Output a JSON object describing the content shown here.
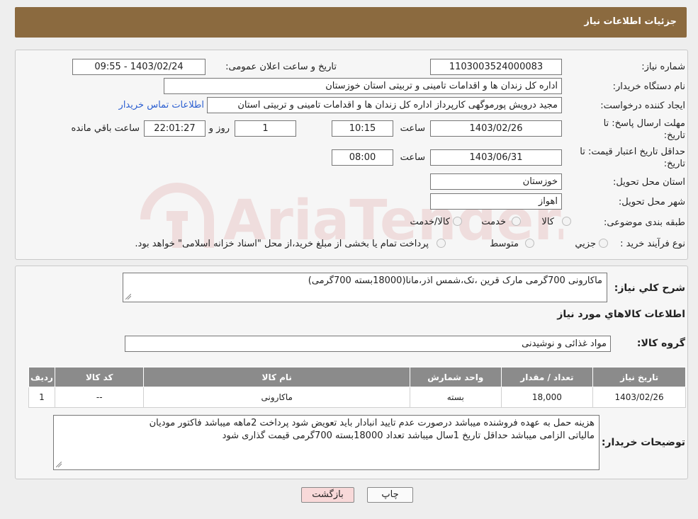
{
  "header": {
    "title": "جزئیات اطلاعات نیاز"
  },
  "form": {
    "need_number": {
      "label": "شماره نیاز:",
      "value": "1103003524000083"
    },
    "announce_datetime": {
      "label": "تاریخ و ساعت اعلان عمومی:",
      "value": "1403/02/24 - 09:55"
    },
    "buyer_org": {
      "label": "نام دستگاه خریدار:",
      "value": "اداره کل زندان ها و اقدامات تامینی و تربیتی استان خوزستان"
    },
    "requester": {
      "label": "ایجاد کننده درخواست:",
      "value": "مجید درویش پورموگهی کارپرداز اداره کل زندان ها و اقدامات تامینی و تربیتی استان",
      "link": "اطلاعات تماس خریدار"
    },
    "reply_deadline": {
      "label_line1": "مهلت ارسال پاسخ: تا",
      "label_line2": "تاریخ:",
      "date": "1403/02/26",
      "time_label": "ساعت",
      "time": "10:15",
      "days": "1",
      "days_label": "روز و",
      "remaining": "22:01:27",
      "remaining_label": "ساعت باقي مانده"
    },
    "price_validity": {
      "label_line1": "حداقل تاریخ اعتبار قیمت: تا",
      "label_line2": "تاریخ:",
      "date": "1403/06/31",
      "time_label": "ساعت",
      "time": "08:00"
    },
    "province": {
      "label": "استان محل تحویل:",
      "value": "خوزستان"
    },
    "city": {
      "label": "شهر محل تحویل:",
      "value": "اهواز"
    },
    "category": {
      "label": "طبقه بندی موضوعی:",
      "options": [
        "کالا",
        "خدمت",
        "کالا/خدمت"
      ]
    },
    "purchase_type": {
      "label": "نوع فرآیند خرید :",
      "options": [
        "جزيي",
        "متوسط"
      ],
      "note": "پرداخت تمام یا بخشی از مبلغ خرید،از محل \"اسناد خزانه اسلامی\" خواهد بود."
    }
  },
  "details": {
    "summary_label": "شرح کلي نياز:",
    "summary_value": "ماکارونی 700گرمی مارک قرین ،تک،شمس اذر،مانا(18000بسته 700گرمی)",
    "items_title": "اطلاعات کالاهاي مورد نياز",
    "group_label": "گروه کالا:",
    "group_value": "مواد غذائی و نوشیدنی",
    "table": {
      "headers": [
        "رديف",
        "کد کالا",
        "نام کالا",
        "واحد شمارش",
        "تعداد / مقدار",
        "تاريخ نياز"
      ],
      "rows": [
        [
          "1",
          "--",
          "ماکارونی",
          "بسته",
          "18,000",
          "1403/02/26"
        ]
      ]
    },
    "buyer_notes_label": "توضیحات خریدار:",
    "buyer_notes_line1": "هزینه حمل به عهده فروشنده میباشد درصورت عدم تایید انبادار باید تعویض شود پرداخت 2ماهه میباشد فاکتور مودیان",
    "buyer_notes_line2": "مالیاتی الزامی میباشد حداقل تاریخ 1سال میباشد تعداد 18000بسته 700گرمی قیمت گذاری شود"
  },
  "buttons": {
    "print": "چاپ",
    "back": "بازگشت"
  },
  "watermark": {
    "text": "AriaTender.neT"
  },
  "colors": {
    "header_bg": "#8b6a3f",
    "table_header_bg": "#8b8b8b",
    "link": "#2c5fd1",
    "back_button_bg": "#f8d9d9"
  }
}
